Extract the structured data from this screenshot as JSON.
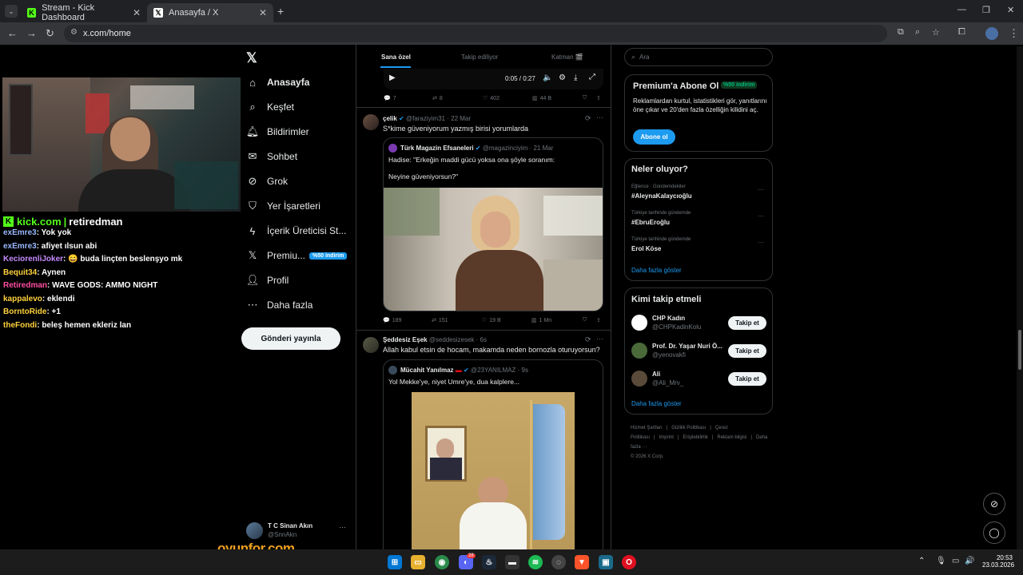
{
  "browser": {
    "tabs": [
      {
        "title": "Stream - Kick Dashboard",
        "favicon": "K"
      },
      {
        "title": "Anasayfa / X",
        "favicon": "𝕏"
      }
    ],
    "url": "x.com/home",
    "colors": {
      "kick": "#53fc18",
      "tabbar": "#202124"
    }
  },
  "stream": {
    "channel_site": "kick.com",
    "channel_name": "retiredman",
    "watermark": "oyunfor.com",
    "chat": [
      {
        "user": "exEmre3",
        "msg": ": Yok yok",
        "color": "#9ab8ff"
      },
      {
        "user": "exEmre3",
        "msg": ": afiyet ılsun abi",
        "color": "#9ab8ff"
      },
      {
        "user": "KeciorenliJoker",
        "msg": ": 😄 buda linçten beslenşyo mk",
        "color": "#c78bff"
      },
      {
        "user": "Bequit34",
        "msg": ": Aynen",
        "color": "#ffd23c"
      },
      {
        "user": "Retiredman",
        "msg": ": WAVE GODS: AMMO NIGHT",
        "color": "#ff4fa0"
      },
      {
        "user": "kappalevo",
        "msg": ": eklendi",
        "color": "#ffd23c"
      },
      {
        "user": "BorntoRide",
        "msg": ": +1",
        "color": "#ffd23c"
      },
      {
        "user": "theFondi",
        "msg": ": beleş hemen ekleriz lan",
        "color": "#ffd23c"
      }
    ]
  },
  "sidebar": {
    "items": [
      {
        "label": "Anasayfa",
        "icon": "home-icon"
      },
      {
        "label": "Keşfet",
        "icon": "search-icon"
      },
      {
        "label": "Bildirimler",
        "icon": "bell-icon"
      },
      {
        "label": "Sohbet",
        "icon": "mail-icon"
      },
      {
        "label": "Grok",
        "icon": "grok-icon"
      },
      {
        "label": "Yer İşaretleri",
        "icon": "bookmark-icon"
      },
      {
        "label": "İçerik Üreticisi St...",
        "icon": "bolt-icon"
      },
      {
        "label": "Premiu...",
        "icon": "x-icon"
      },
      {
        "label": "Profil",
        "icon": "person-icon"
      },
      {
        "label": "Daha fazla",
        "icon": "more-circle-icon"
      }
    ],
    "premium_badge": "%50 indirim",
    "post_button": "Gönderi yayınla",
    "account": {
      "name": "T C Sinan Akın",
      "handle": "@SnnAkn"
    }
  },
  "feed": {
    "tabs": [
      "Sana özel",
      "Takip ediliyor",
      "Katman 🎬"
    ],
    "video_time": "0:05 / 0:27",
    "tweet0_actions": [
      "7",
      "8",
      "402",
      "44 B"
    ],
    "tweet1": {
      "name": "çelik",
      "handle": "@faraziyim31",
      "date": "· 22 Mar",
      "text": "S*kime güveniyorum yazmış birisi yorumlarda",
      "quote": {
        "name": "Türk Magazin Efsaneleri",
        "handle": "@magazinciyim",
        "date": "· 21 Mar",
        "line1": "Hadise: \"Erkeğin maddi gücü yoksa ona şöyle soranım:",
        "line2": "Neyine güveniyorsun?\""
      },
      "actions": [
        "189",
        "151",
        "19 B",
        "1 Mn"
      ]
    },
    "tweet2": {
      "name": "Şeddesiz Eşek",
      "handle": "@seddesizesek",
      "date": "· 6s",
      "text": "Allah kabul etsin de hocam, makamda neden bornozla oturuyorsun?",
      "quote": {
        "name": "Mücahit Yanılmaz",
        "handle": "@23YANILMAZ",
        "date": "· 9s",
        "text": "Yol Mekke'ye, niyet Umre'ye, dua kalplere..."
      }
    }
  },
  "right": {
    "search_placeholder": "Ara",
    "premium": {
      "title": "Premium'a Abone Ol",
      "badge": "%50 indirim",
      "desc": "Reklamlardan kurtul, istatistikleri gör, yanıtlarını öne çıkar ve 20'den fazla özelliğin kilidini aç.",
      "button": "Abone ol"
    },
    "trends": {
      "title": "Neler oluyor?",
      "items": [
        {
          "context": "Eğlence · Gündemdekiler",
          "name": "#AleynaKalaycıoğlu"
        },
        {
          "context": "Türkiye tarihinde gündemde",
          "name": "#EbruEroğlu"
        },
        {
          "context": "Türkiye tarihinde gündemde",
          "name": "Erol Köse"
        }
      ],
      "more": "Daha fazla göster"
    },
    "follow": {
      "title": "Kimi takip etmeli",
      "items": [
        {
          "name": "CHP Kadın",
          "handle": "@CHPKadinKolu",
          "button": "Takip et"
        },
        {
          "name": "Prof. Dr. Yaşar Nuri Ö...",
          "handle": "@yenovakfi",
          "button": "Takip et"
        },
        {
          "name": "Ali",
          "handle": "@Ali_Mrv_",
          "button": "Takip et"
        }
      ],
      "more": "Daha fazla göster"
    },
    "footer": [
      "Hizmet Şartları",
      "|",
      "Gizlilik Politikası",
      "|",
      "Çerez Politikası",
      "|",
      "Imprint",
      "|",
      "Erişilebilirlik",
      "|",
      "Reklam bilgisi",
      "|",
      "Daha fazla ···",
      "© 2026 X Corp."
    ]
  },
  "taskbar": {
    "time": "20:53",
    "date": "23.03.2026",
    "discord_badge": "28"
  }
}
